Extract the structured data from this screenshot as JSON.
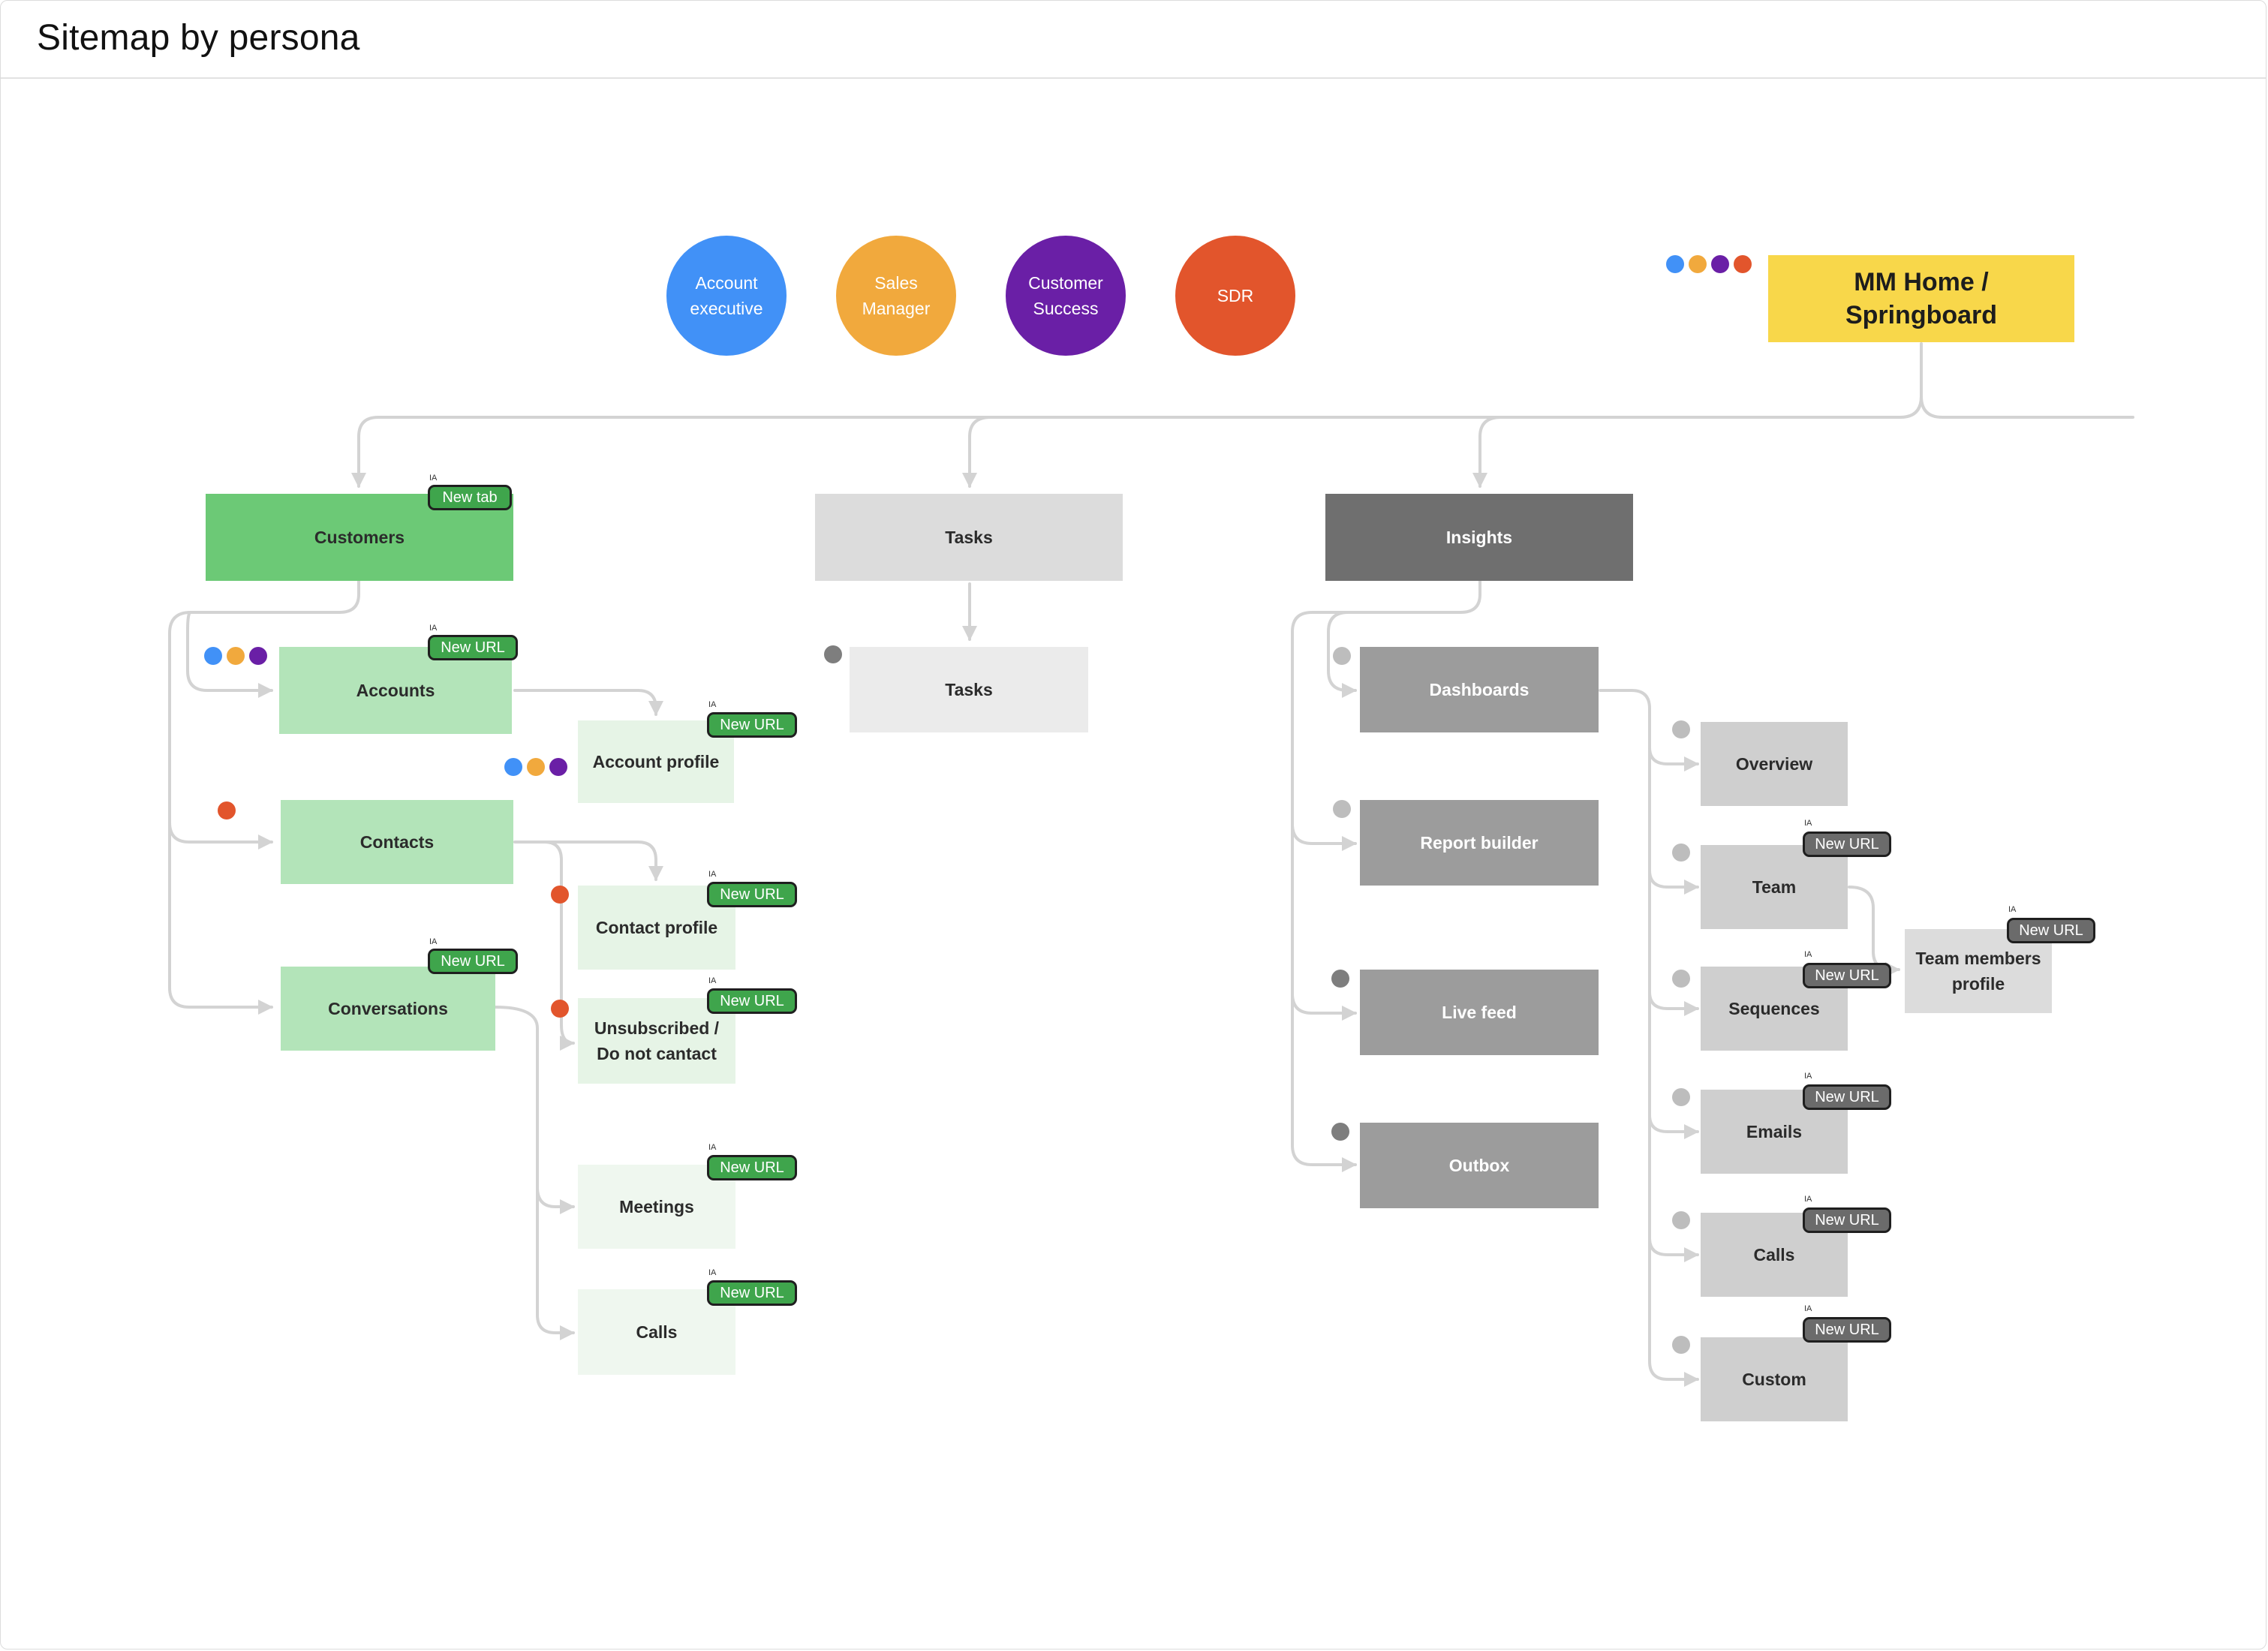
{
  "page_title": "Sitemap by persona",
  "colors": {
    "account_executive": "#4191F7",
    "sales_manager": "#F1A93D",
    "customer_success": "#6A1FA6",
    "sdr": "#E2552C",
    "home": "#F8D74A",
    "customers": "#6CC976",
    "customers_l1": "#B3E4B9",
    "customers_l2": "#E6F4E6",
    "customers_l2_light": "#EFF7EF",
    "tasks": "#DCDCDC",
    "tasks_l1": "#EBEBEB",
    "insights": "#6F6F6F",
    "insights_l1": "#9C9C9C",
    "insights_l2": "#CFCFCF",
    "insights_l3": "#DCDCDC",
    "badge_green": "#3FA54C",
    "badge_gray": "#6B6B6B",
    "connector": "#D3D3D3",
    "dot_gray_dark": "#7E7E7E",
    "dot_gray_light": "#BDBDBD"
  },
  "personas": [
    {
      "label": "Account\nexecutive",
      "color": "#4191F7"
    },
    {
      "label": "Sales\nManager",
      "color": "#F1A93D"
    },
    {
      "label": "Customer\nSuccess",
      "color": "#6A1FA6"
    },
    {
      "label": "SDR",
      "color": "#E2552C"
    }
  ],
  "home": {
    "label": "MM Home /\nSpringboard"
  },
  "ia_label": "IA",
  "nodes": {
    "customers": "Customers",
    "tasks": "Tasks",
    "insights": "Insights",
    "accounts": "Accounts",
    "contacts": "Contacts",
    "conversations": "Conversations",
    "account_profile": "Account profile",
    "contact_profile": "Contact profile",
    "unsubscribed": "Unsubscribed /\nDo not cantact",
    "meetings": "Meetings",
    "calls_customers": "Calls",
    "tasks_child": "Tasks",
    "dashboards": "Dashboards",
    "report_builder": "Report builder",
    "live_feed": "Live feed",
    "outbox": "Outbox",
    "overview": "Overview",
    "team": "Team",
    "sequences": "Sequences",
    "emails": "Emails",
    "calls_insights": "Calls",
    "custom": "Custom",
    "team_members_profile": "Team members\nprofile"
  },
  "badges": {
    "new_tab": "New tab",
    "new_url": "New URL"
  }
}
